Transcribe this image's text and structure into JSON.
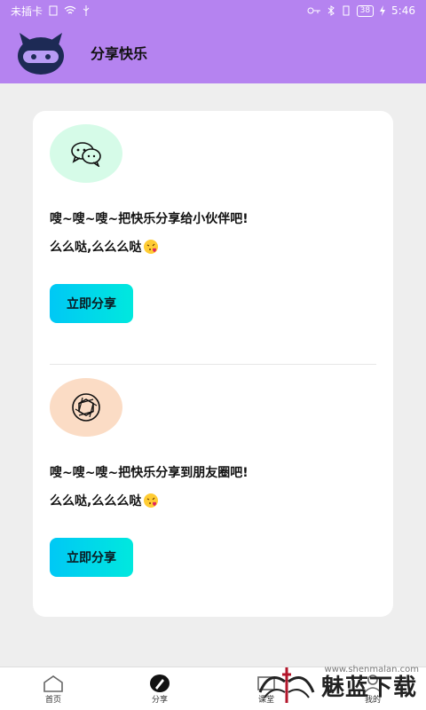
{
  "status_bar": {
    "carrier": "未插卡",
    "battery": "38",
    "time": "5:46"
  },
  "header": {
    "title": "分享快乐"
  },
  "shares": [
    {
      "text": "嗖~嗖~嗖~把快乐分享给小伙伴吧!",
      "subtext": "么么哒,么么么哒",
      "button": "立即分享",
      "icon": "wechat-icon"
    },
    {
      "text": "嗖~嗖~嗖~把快乐分享到朋友圈吧!",
      "subtext": "么么哒,么么么哒",
      "button": "立即分享",
      "icon": "moments-aperture-icon"
    }
  ],
  "nav": {
    "items": [
      "首页",
      "分享",
      "课堂",
      "我的"
    ],
    "active": "分享"
  },
  "watermark": {
    "text": "魅蓝下载",
    "url": "www.shenmalan.com"
  }
}
